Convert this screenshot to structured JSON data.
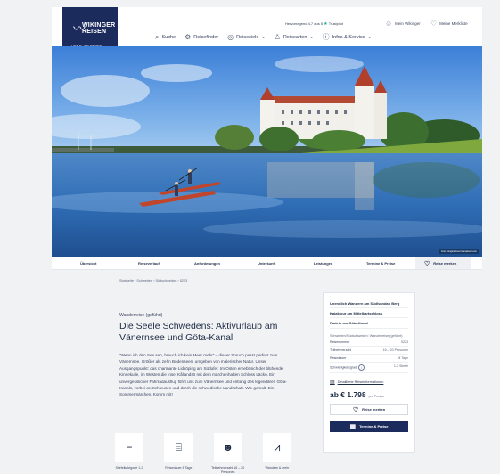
{
  "brand": {
    "name": "WIKINGER\nREISEN",
    "name_line1": "WIKINGER",
    "name_line2": "REISEN",
    "tagline": "Urlaub, der bewegt",
    "color": "#1b2b5c"
  },
  "header": {
    "trust_text": "Hervorragend 4,7 aus 5",
    "trust_brand": "Trustpilot",
    "my_wikinger": "Mein Wikinger",
    "watchlist": "Meine Merkliste",
    "nav": [
      {
        "label": "Suche",
        "icon": "search-icon"
      },
      {
        "label": "Reisefinder",
        "icon": "finder-icon"
      },
      {
        "label": "Reiseziele",
        "icon": "globe-icon",
        "dropdown": true
      },
      {
        "label": "Reisearten",
        "icon": "hiker-icon",
        "dropdown": true
      },
      {
        "label": "Infos & Service",
        "icon": "info-icon",
        "dropdown": true
      }
    ]
  },
  "hero": {
    "credit": "Foto: fotogloeckner/mamaknorr.com"
  },
  "tabs": [
    "Übersicht",
    "Reiseverlauf",
    "Anforderungen",
    "Unterkunft",
    "Leistungen",
    "Termine & Preise"
  ],
  "remember_label": "Reise merken",
  "breadcrumb": "Startseite › Schweden › Südschweden › 5223",
  "trip": {
    "kicker": "Wanderreise (geführt)",
    "title": "Die Seele Schwedens: Aktivurlaub am Vänernsee und Göta-Kanal",
    "intro": "\"Wenn ich den See seh, brauch ich kein Meer mehr\" – dieser Spruch passt perfekt zum Vänernsee. Größer als zehn Bodenseen, umgeben von malerischer Natur. Unser Ausgangspunkt: das charmante Lidköping am Südufer. Im Osten erhebt sich der blühende Kinnekulle, im Westen die Insel Kållandsö mit dem märchenhaften Schloss Läckö. Ein unvergesslicher Fahrradausflug führt uns zum Vänernsee und entlang des legendären Göta-Kanals, vorbei an Schleusen und durch die schwedische Landschaft. Wie gemalt. Ein Sommermärchen. Komm mit!"
  },
  "features": [
    {
      "label": "Stiefelkategorie 1-2",
      "icon": "boot-icon"
    },
    {
      "label": "Reisedauer 8 Tage",
      "icon": "suitcase-icon"
    },
    {
      "label": "Teilnehmerzahl 16 – 20 Personen",
      "icon": "group-icon"
    },
    {
      "label": "Wandern & mehr",
      "icon": "mountain-icon"
    }
  ],
  "card": {
    "links": [
      "Unendlich Wandern am Südlvandan Berg",
      "Kajaktour am Mittelkartschloss",
      "Radeln am Göta-Kanal"
    ],
    "sub": "Schweden/Südschweden: Wanderreise (geführt)",
    "facts": [
      {
        "k": "Reisenummer",
        "v": "5223"
      },
      {
        "k": "Teilnehmerzahl",
        "v": "16 – 20 Personen"
      },
      {
        "k": "Reisedauer",
        "v": "8 Tage"
      },
      {
        "k": "Schwierigkeitsgrad",
        "v": "1-2 Stiefel"
      }
    ],
    "detail_link": "Detaillierte Reiseinformationen",
    "price": "ab € 1.798",
    "price_unit": "pro Person",
    "remember": "Reise merken",
    "dates_button": "Termine & Preise"
  }
}
